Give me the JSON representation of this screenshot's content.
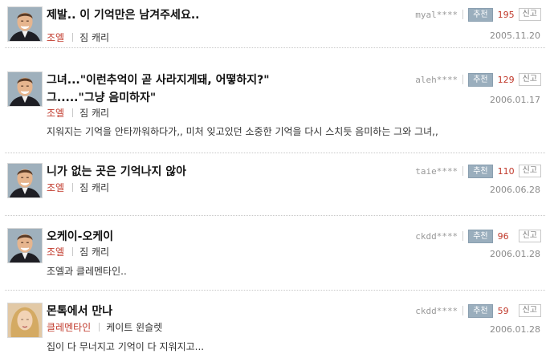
{
  "labels": {
    "recommend": "추천",
    "report": "신고"
  },
  "items": [
    {
      "quote_lines": [
        "제발.. 이 기억만은 남겨주세요.."
      ],
      "character": "조엘",
      "actor": "짐 캐리",
      "writer": "myal****",
      "count": "195",
      "date": "2005.11.20",
      "desc": "",
      "avatar": "man-photo"
    },
    {
      "quote_lines": [
        "그녀...\"이런추억이 곧 사라지게돼, 어떻하지?\"",
        "그.....\"그냥 음미하자\""
      ],
      "character": "조엘",
      "actor": "짐 캐리",
      "writer": "aleh****",
      "count": "129",
      "date": "2006.01.17",
      "desc": "지워지는 기억을 안타까워하다가,, 미처 잊고있던 소중한 기억을 다시 스치듯 음미하는 그와 그녀,,",
      "avatar": "man-photo"
    },
    {
      "quote_lines": [
        "니가 없는 곳은 기억나지 않아"
      ],
      "character": "조엘",
      "actor": "짐 캐리",
      "writer": "taie****",
      "count": "110",
      "date": "2006.06.28",
      "desc": "",
      "avatar": "man-photo"
    },
    {
      "quote_lines": [
        "오케이-오케이"
      ],
      "character": "조엘",
      "actor": "짐 캐리",
      "writer": "ckdd****",
      "count": "96",
      "date": "2006.01.28",
      "desc": "조엘과 클레멘타인..",
      "avatar": "man-photo"
    },
    {
      "quote_lines": [
        "몬톡에서 만나"
      ],
      "character": "클레멘타인",
      "actor": "케이트 윈슬렛",
      "writer": "ckdd****",
      "count": "59",
      "date": "2006.01.28",
      "desc": "집이 다 무너지고 기억이 다 지워지고...",
      "avatar": "woman-photo"
    }
  ]
}
